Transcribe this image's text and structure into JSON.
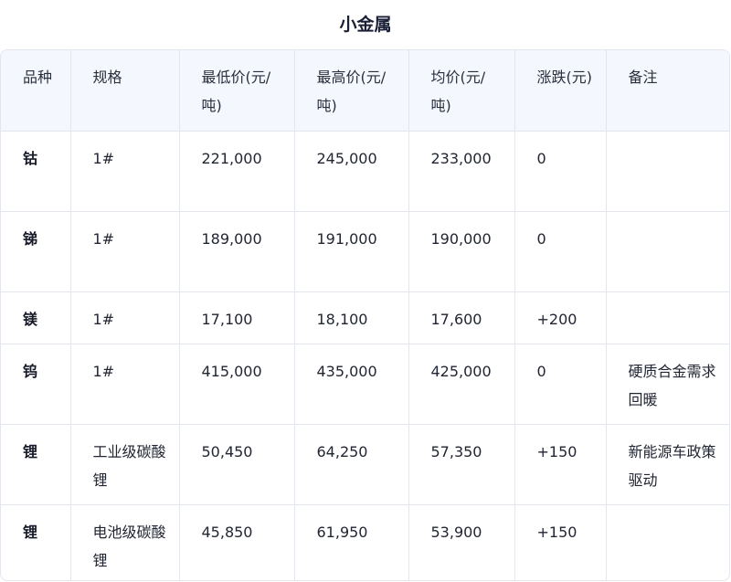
{
  "title": "小金属",
  "headers": [
    "品种",
    "规格",
    "最低价(元/吨)",
    "最高价(元/吨)",
    "均价(元/吨)",
    "涨跌(元)",
    "备注"
  ],
  "rows": [
    [
      "钴",
      "1#",
      "221,000",
      "245,000",
      "233,000",
      "0",
      ""
    ],
    [
      "锑",
      "1#",
      "189,000",
      "191,000",
      "190,000",
      "0",
      ""
    ],
    [
      "镁",
      "1#",
      "17,100",
      "18,100",
      "17,600",
      "+200",
      ""
    ],
    [
      "钨",
      "1#",
      "415,000",
      "435,000",
      "425,000",
      "0",
      "硬质合金需求回暖"
    ],
    [
      "锂",
      "工业级碳酸锂",
      "50,450",
      "64,250",
      "57,350",
      "+150",
      "新能源车政策驱动"
    ],
    [
      "锂",
      "电池级碳酸锂",
      "45,850",
      "61,950",
      "53,900",
      "+150",
      ""
    ]
  ]
}
